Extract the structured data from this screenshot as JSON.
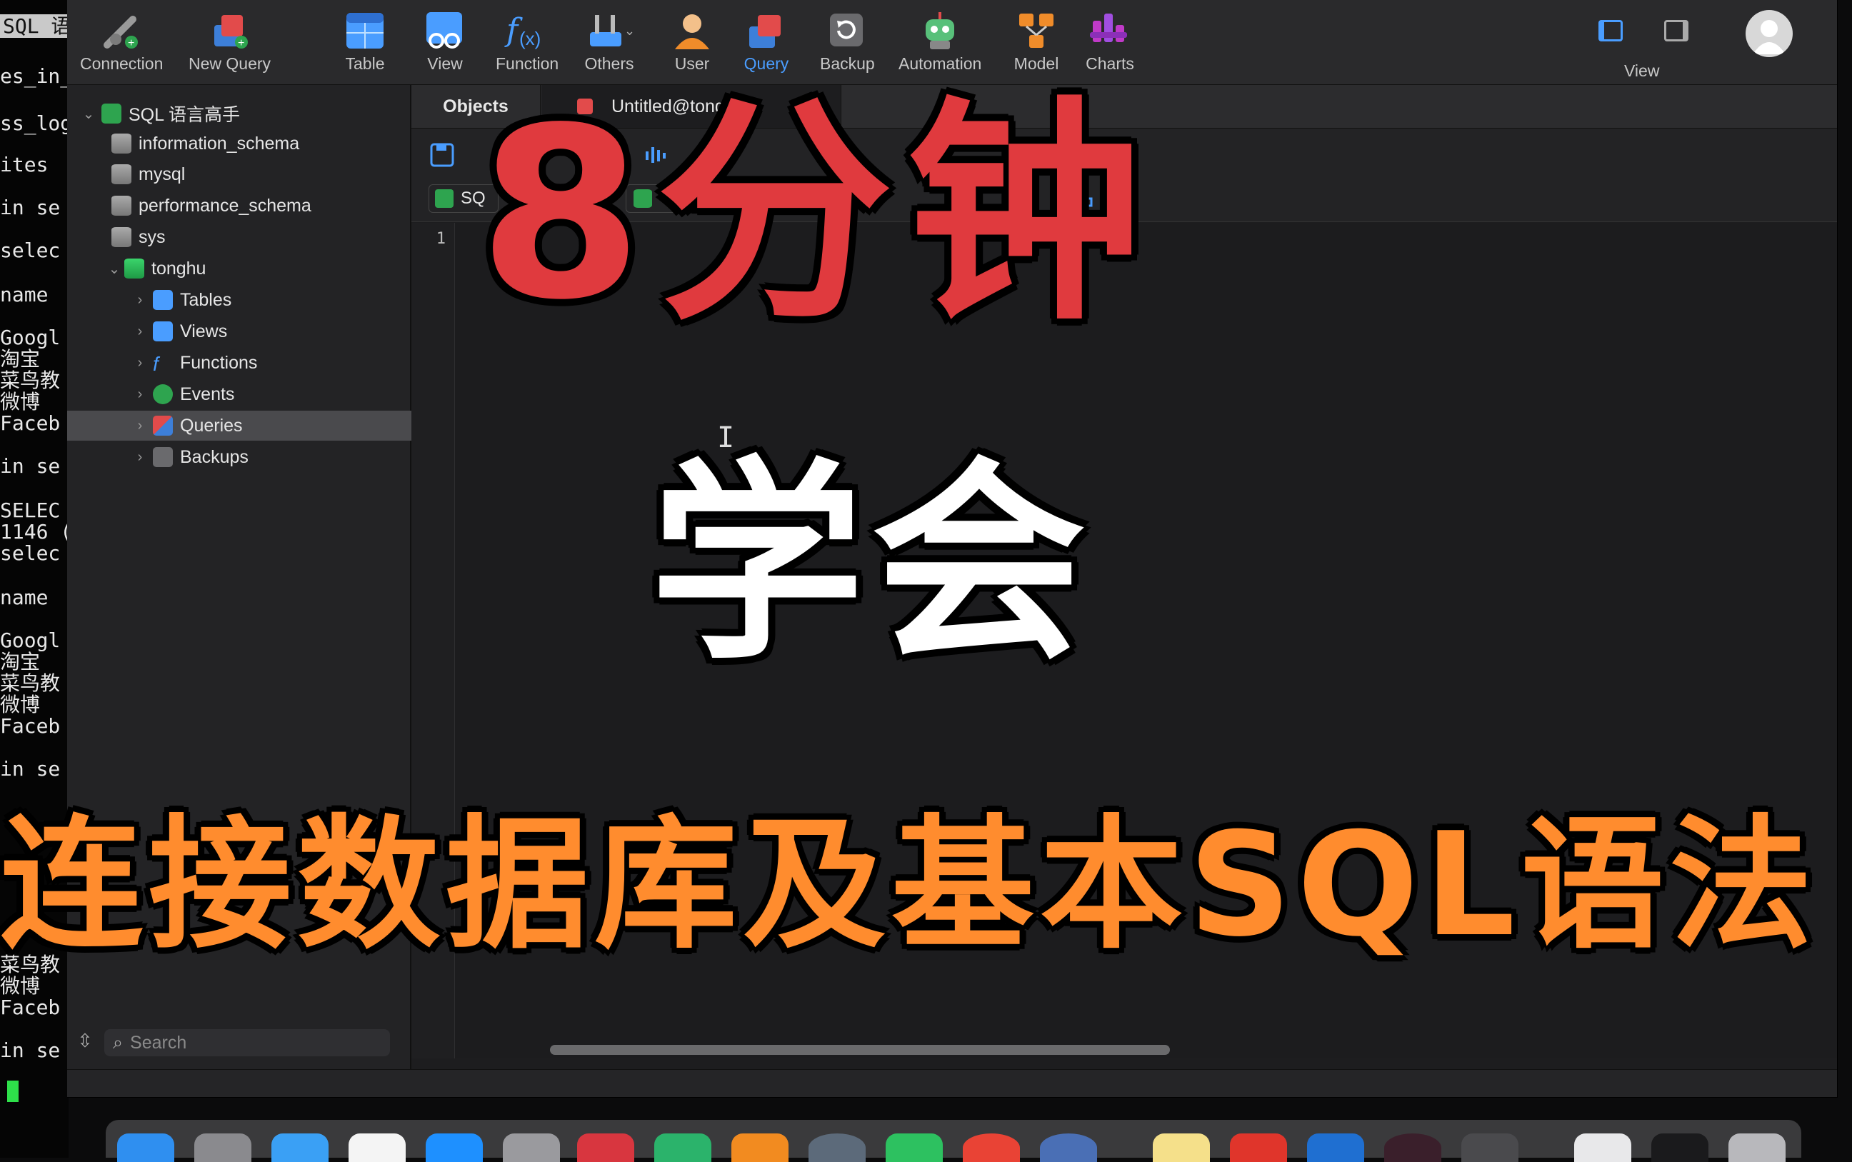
{
  "terminal": {
    "tab_title": "SQL 语言",
    "lines": [
      "es_in_",
      "ss_log",
      "ites",
      "in se",
      "selec",
      "name",
      "Googl",
      "淘宝",
      "菜鸟教",
      "微博",
      "Faceb",
      "in se",
      "SELEC",
      "1146 (",
      "selec",
      "name",
      "Googl",
      "淘宝",
      "菜鸟教",
      "微博",
      "Faceb",
      "in se",
      "菜鸟教",
      "微博",
      "Faceb",
      "in se"
    ]
  },
  "toolbar": {
    "items": [
      {
        "label": "Connection",
        "icon": "connection-icon"
      },
      {
        "label": "New Query",
        "icon": "new-query-icon"
      },
      {
        "label": "Table",
        "icon": "table-icon"
      },
      {
        "label": "View",
        "icon": "view-icon"
      },
      {
        "label": "Function",
        "icon": "function-icon"
      },
      {
        "label": "Others",
        "icon": "others-icon"
      },
      {
        "label": "User",
        "icon": "user-icon"
      },
      {
        "label": "Query",
        "icon": "query-icon",
        "active": true
      },
      {
        "label": "Backup",
        "icon": "backup-icon"
      },
      {
        "label": "Automation",
        "icon": "automation-icon"
      },
      {
        "label": "Model",
        "icon": "model-icon"
      },
      {
        "label": "Charts",
        "icon": "charts-icon"
      }
    ],
    "view_label": "View",
    "accent": "#4a9dff"
  },
  "sidebar": {
    "connection": "SQL 语言高手",
    "databases": [
      "information_schema",
      "mysql",
      "performance_schema",
      "sys",
      "tonghu"
    ],
    "tonghu_children": [
      "Tables",
      "Views",
      "Functions",
      "Events",
      "Queries",
      "Backups"
    ],
    "selected": "Queries",
    "search_placeholder": "Search"
  },
  "tabs": {
    "objects": "Objects",
    "untitled": "Untitled@tongh"
  },
  "editor": {
    "line_number": "1",
    "sql_chip": "SQ"
  },
  "overlay": {
    "main": "8分钟",
    "sub": "学会",
    "bottom": "连接数据库及基本SQL语法",
    "colors": {
      "main": "#e03a3e",
      "sub": "#ffffff",
      "bottom": "#ff8c2e"
    }
  }
}
